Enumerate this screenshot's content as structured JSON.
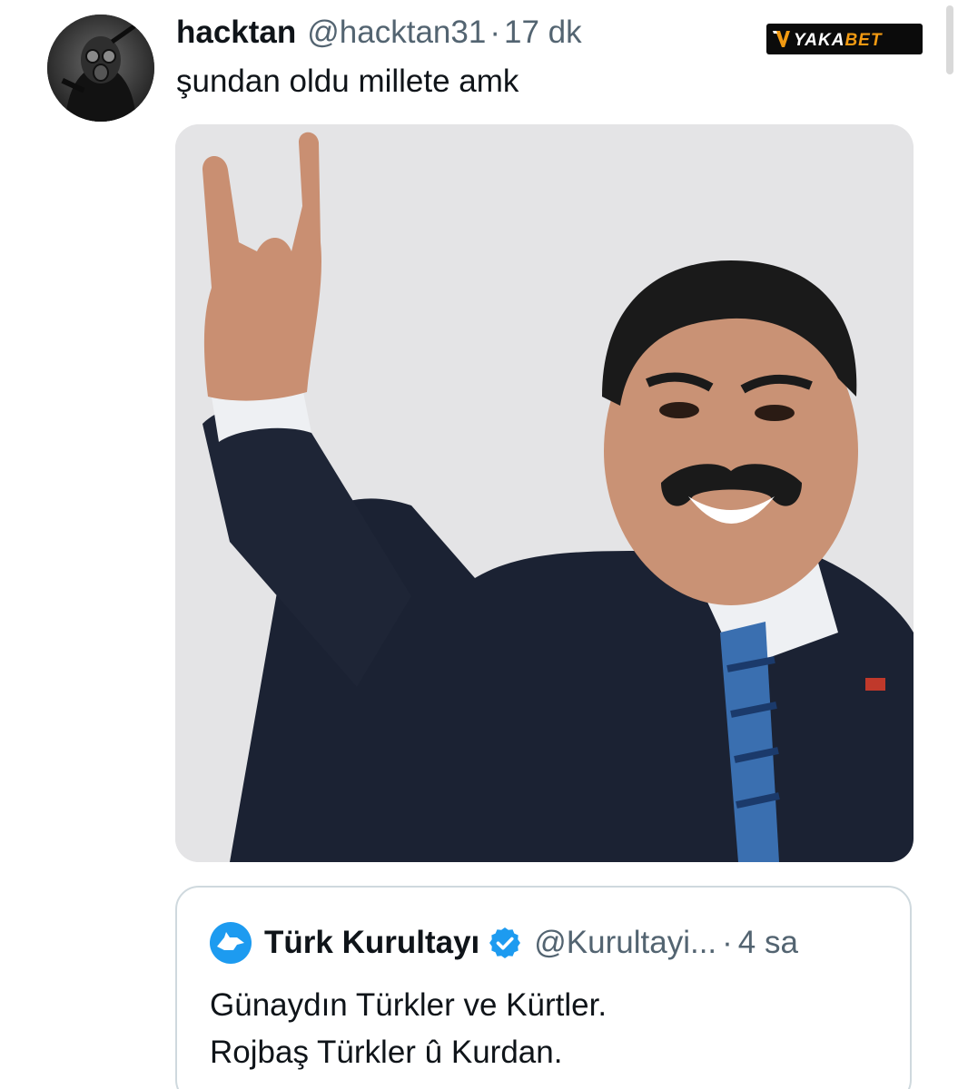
{
  "tweet": {
    "author": {
      "display_name": "hacktan",
      "handle": "@hacktan31",
      "separator": "·",
      "time": "17 dk",
      "avatar_icon": "gas-mask-avatar"
    },
    "text": "şundan oldu millete amk",
    "media": {
      "icon": "photo-man-hand-gesture",
      "background": "#e4e4e6"
    }
  },
  "watermark": {
    "text": "YAKABET",
    "text_part1": "YAKA",
    "text_part2": "BET",
    "color_primary": "#ffffff",
    "color_accent": "#f29a12"
  },
  "quote": {
    "author": {
      "display_name": "Türk Kurultayı",
      "handle": "@Kurultayi...",
      "separator": "·",
      "time": "4 sa",
      "avatar_icon": "wolf-head-avatar",
      "verified_icon": "verified-badge-icon"
    },
    "text_lines": [
      "Günaydın Türkler ve Kürtler.",
      "Rojbaş Türkler û Kurdan."
    ]
  },
  "colors": {
    "text_primary": "#0f1419",
    "text_secondary": "#536471",
    "border": "#cfd9de",
    "verified": "#1d9bf0"
  }
}
